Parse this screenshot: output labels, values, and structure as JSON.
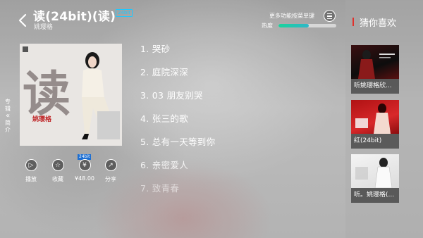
{
  "header": {
    "title": "读(24bit)(读)",
    "badge": "24bit",
    "artist": "姚璎格",
    "more_functions": "更多功能按菜单键",
    "heat_label": "热度",
    "heat_level": 0.52
  },
  "side_tab": {
    "chars": [
      "专",
      "辑",
      "简",
      "介"
    ],
    "chevron": "«"
  },
  "album": {
    "cover_char": "读",
    "cover_signature": "姚璎格"
  },
  "actions": [
    {
      "label": "播放",
      "icon": "play-icon",
      "glyph": "▷"
    },
    {
      "label": "收藏",
      "icon": "star-icon",
      "glyph": "☆"
    },
    {
      "label": "¥48.00",
      "icon": "yen-icon",
      "glyph": "¥"
    },
    {
      "label": "分享",
      "icon": "share-icon",
      "glyph": "↗"
    }
  ],
  "price_badge": "24bit",
  "tracks": [
    "1. 哭砂",
    "2. 庭院深深",
    "3. 03 朋友别哭",
    "4. 张三的歌",
    "5. 总有一天等到你",
    "6. 亲密爱人",
    "7. 致青春"
  ],
  "recommend": {
    "title": "猜你喜欢",
    "items": [
      {
        "label": "听姚璎格欣..."
      },
      {
        "label": "红(24bit)"
      },
      {
        "label": "听。姚璎格(..."
      }
    ]
  },
  "colors": {
    "accent_red": "#e0302b",
    "heat_green": "#19d39b",
    "badge_blue": "#1ec8ff"
  }
}
